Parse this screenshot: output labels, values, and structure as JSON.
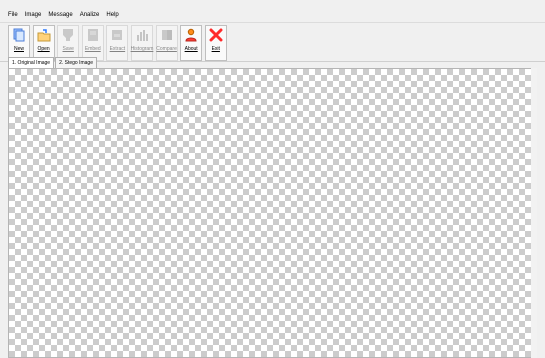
{
  "menu": [
    "File",
    "Image",
    "Message",
    "Analize",
    "Help"
  ],
  "toolbar": {
    "new": "New",
    "open": "Open",
    "save": "Save",
    "embed": "Embed",
    "extract": "Extract",
    "histogram": "Histogram",
    "compare": "Compare",
    "about": "About",
    "exit": "Exit"
  },
  "tabs": [
    "1. Original Image",
    "2. Stego Image"
  ]
}
